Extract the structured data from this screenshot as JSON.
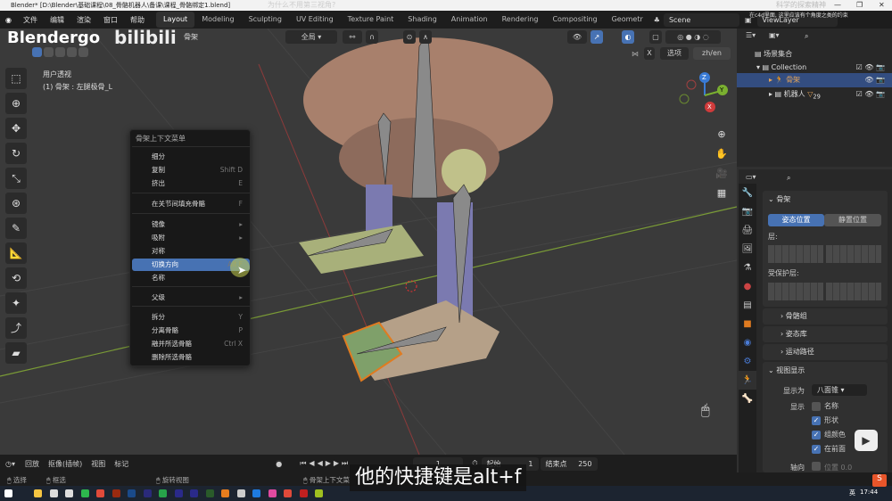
{
  "window": {
    "title": "Blender* [D:\\Blender\\基础课程\\08_骨骼机器人\\备课\\课程_骨骼绑定1.blend]",
    "min": "—",
    "max": "❐",
    "close": "✕"
  },
  "menu": [
    "文件",
    "编辑",
    "渲染",
    "窗口",
    "帮助"
  ],
  "workspaces": [
    "Layout",
    "Modeling",
    "Sculpting",
    "UV Editing",
    "Texture Paint",
    "Shading",
    "Animation",
    "Rendering",
    "Compositing",
    "Geometr"
  ],
  "scene": "Scene",
  "view_layer": "ViewLayer",
  "watermark": {
    "brand": "Blendergo",
    "site": "bilibili"
  },
  "viewport": {
    "mode_label": "骨架",
    "transform": "全局",
    "options": "选项",
    "lang": "zh/en",
    "view_name": "用户透视",
    "object_info": "(1) 骨架 : 左腿极骨_L",
    "axes": {
      "x": "X",
      "y": "Y",
      "z": "Z"
    }
  },
  "context_menu": {
    "title": "骨架上下文菜单",
    "items": [
      {
        "label": "细分",
        "shortcut": ""
      },
      {
        "label": "复制",
        "shortcut": "Shift D"
      },
      {
        "label": "挤出",
        "shortcut": "E"
      },
      {
        "label": "在关节间填充骨骼",
        "shortcut": "F"
      },
      {
        "label": "镜像",
        "shortcut": "▸"
      },
      {
        "label": "吸附",
        "shortcut": "▸"
      },
      {
        "label": "对称",
        "shortcut": ""
      },
      {
        "label": "切换方向",
        "shortcut": "Alt F"
      },
      {
        "label": "名称",
        "shortcut": ""
      },
      {
        "label": "父级",
        "shortcut": "▸"
      },
      {
        "label": "拆分",
        "shortcut": "Y"
      },
      {
        "label": "分离骨骼",
        "shortcut": "P"
      },
      {
        "label": "融并所选骨骼",
        "shortcut": "Ctrl X"
      },
      {
        "label": "删除所选骨骼",
        "shortcut": ""
      }
    ],
    "selected": "切换方向"
  },
  "outliner": {
    "root": "场景集合",
    "items": [
      "Collection",
      "骨架",
      "机器人"
    ],
    "badge": "29"
  },
  "properties": {
    "section": "骨架",
    "pose_position": "姿态位置",
    "rest_position": "静置位置",
    "layers": "层:",
    "protected_layers": "受保护层:",
    "panels": [
      "骨骼组",
      "姿态库",
      "运动路径",
      "视图显示"
    ],
    "display_as_label": "显示为",
    "display_as_value": "八面锥",
    "show_label": "显示",
    "checks": [
      {
        "label": "名称",
        "checked": false
      },
      {
        "label": "形状",
        "checked": true
      },
      {
        "label": "组颜色",
        "checked": true
      },
      {
        "label": "在前面",
        "checked": true
      }
    ],
    "axes_label": "轴向",
    "position_label": "位置",
    "position_value": "0.0"
  },
  "timeline": {
    "playback": "回放",
    "keying": "抠像(插帧)",
    "view": "视图",
    "marker": "标记",
    "current_frame": "1",
    "start_label": "起始",
    "start": "1",
    "end_label": "结束点",
    "end": "250"
  },
  "statusbar": {
    "select": "选择",
    "box_select": "框选",
    "rotate_view": "旋转视图",
    "context_menu": "骨架上下文菜"
  },
  "subtitle": "他的快捷键是alt+f",
  "overlay_text": [
    "为什么不用第三视角?",
    "科学的探索精神",
    "在c4d里面, 这里应该有个角度之类的约束"
  ],
  "taskbar": {
    "time": "17:44",
    "ime": "英"
  },
  "colors": {
    "accent": "#4772b3",
    "bone_selected": "#e3a45a"
  }
}
